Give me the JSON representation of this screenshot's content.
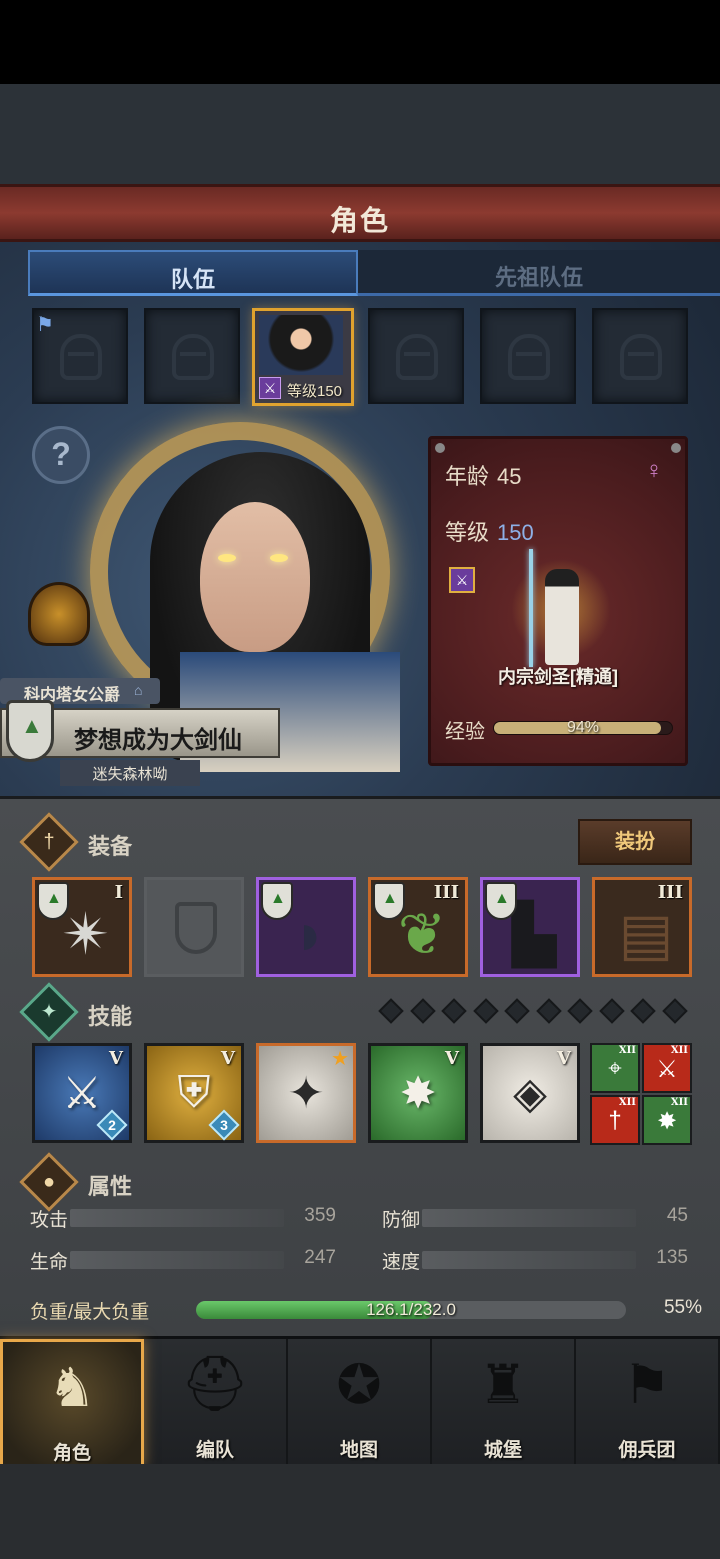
{
  "header": {
    "title": "角色"
  },
  "tabs": [
    {
      "label": "队伍",
      "active": true
    },
    {
      "label": "先祖队伍",
      "active": false
    }
  ],
  "team_slots": {
    "selected_index": 2,
    "selected_level_label": "等级150"
  },
  "hero": {
    "noble_title": "科内塔女公爵",
    "name": "梦想成为大剑仙",
    "origin": "迷失森林呦"
  },
  "info_card": {
    "age_label": "年龄",
    "age_value": "45",
    "level_label": "等级",
    "level_value": "150",
    "class_name": "内宗剑圣[精通]",
    "exp_label": "经验",
    "exp_percent_text": "94%",
    "exp_fraction": 0.94
  },
  "equipment": {
    "section_title": "装备",
    "dress_button": "装扮",
    "slots": [
      {
        "tier": "I",
        "style": "orange",
        "empty": false,
        "art": "shuriken"
      },
      {
        "tier": "",
        "style": "empty",
        "empty": true,
        "art": ""
      },
      {
        "tier": "",
        "style": "purple",
        "empty": false,
        "art": "hood"
      },
      {
        "tier": "III",
        "style": "orange",
        "empty": false,
        "art": "armor"
      },
      {
        "tier": "",
        "style": "purple",
        "empty": false,
        "art": "boots"
      },
      {
        "tier": "III",
        "style": "orange",
        "empty": false,
        "art": "book"
      }
    ]
  },
  "skills": {
    "section_title": "技能",
    "diamond_count": 10,
    "items": [
      {
        "rank": "V",
        "style": "blue",
        "glyph": "⚔",
        "badge": "2"
      },
      {
        "rank": "V",
        "style": "gold",
        "glyph": "⛨",
        "badge": "3"
      },
      {
        "rank": "",
        "style": "orange",
        "glyph": "✦",
        "badge": "",
        "starred": true
      },
      {
        "rank": "V",
        "style": "green",
        "glyph": "✸",
        "badge": ""
      },
      {
        "rank": "V",
        "style": "grey",
        "glyph": "◈",
        "badge": ""
      }
    ],
    "small_items": [
      {
        "rank": "XII",
        "color": "#3a7a3a",
        "glyph": "⌖"
      },
      {
        "rank": "XII",
        "color": "#b82a1a",
        "glyph": "⚔"
      },
      {
        "rank": "XII",
        "color": "#b82a1a",
        "glyph": "†"
      },
      {
        "rank": "XII",
        "color": "#3a7a3a",
        "glyph": "✸"
      }
    ]
  },
  "attributes": {
    "section_title": "属性",
    "attack_label": "攻击",
    "attack_value": "359",
    "defense_label": "防御",
    "defense_value": "45",
    "hp_label": "生命",
    "hp_value": "247",
    "speed_label": "速度",
    "speed_value": "135",
    "load_label": "负重/最大负重",
    "load_text": "126.1/232.0",
    "load_percent_text": "55%",
    "load_fraction": 0.55
  },
  "nav": [
    {
      "label": "角色",
      "icon": "knight-icon",
      "active": true
    },
    {
      "label": "编队",
      "icon": "helmet-icon",
      "active": false
    },
    {
      "label": "地图",
      "icon": "compass-icon",
      "active": false
    },
    {
      "label": "城堡",
      "icon": "castle-icon",
      "active": false
    },
    {
      "label": "佣兵团",
      "icon": "banner-icon",
      "active": false
    }
  ],
  "colors": {
    "header_red": "#8c3a30",
    "tab_blue": "#5a96de",
    "active_gold": "#e8a84a",
    "rare_purple": "#a060e0",
    "common_orange": "#c86a2a",
    "load_green": "#4aa84a"
  }
}
